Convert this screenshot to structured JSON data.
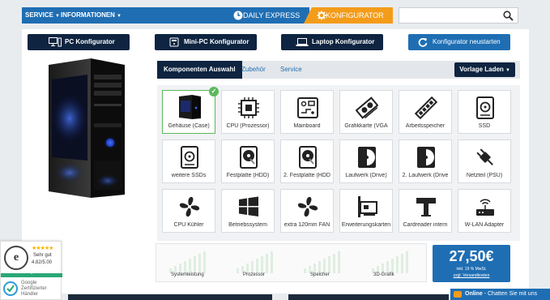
{
  "nav": {
    "service": "SERVICE",
    "informationen": "INFORMATIONEN",
    "daily_express": "DAILY EXPRESS",
    "konfigurator": "KONFIGURATOR",
    "search_placeholder": ""
  },
  "top_buttons": {
    "pc": "PC Konfigurator",
    "mini_pc": "Mini-PC Konfigurator",
    "laptop": "Laptop Konfigurator",
    "restart": "Konfigurator neustarten"
  },
  "tabs": {
    "komponenten": "Komponenten Auswahl",
    "zubehoer": "Zubehör",
    "service": "Service",
    "vorlage": "Vorlage Laden"
  },
  "components": [
    {
      "label": "Gehäuse (Case)",
      "icon": "case-image",
      "selected": true
    },
    {
      "label": "CPU (Prozessor)",
      "icon": "cpu-icon"
    },
    {
      "label": "Mainboard",
      "icon": "mainboard-icon"
    },
    {
      "label": "Grafikkarte (VGA",
      "icon": "graphics-card-icon"
    },
    {
      "label": "Arbeitsspeicher",
      "icon": "ram-icon"
    },
    {
      "label": "SSD",
      "icon": "ssd-icon"
    },
    {
      "label": "weitere SSDs",
      "icon": "ssd-icon"
    },
    {
      "label": "Festplatte (HDD)",
      "icon": "hdd-icon"
    },
    {
      "label": "2. Festplatte (HDD",
      "icon": "hdd-icon"
    },
    {
      "label": "Laufwerk (Drive)",
      "icon": "drive-icon"
    },
    {
      "label": "2. Laufwerk (Drive",
      "icon": "drive-icon"
    },
    {
      "label": "Netzteil (PSU)",
      "icon": "psu-plug-icon"
    },
    {
      "label": "CPU Kühler",
      "icon": "fan-icon"
    },
    {
      "label": "Betriebssystem",
      "icon": "windows-icon"
    },
    {
      "label": "extra 120mm FAN",
      "icon": "fan-icon"
    },
    {
      "label": "Erweiterungskarten",
      "icon": "expansion-card-icon"
    },
    {
      "label": "Cardreader intern",
      "icon": "cardreader-icon"
    },
    {
      "label": "W-LAN Adapter",
      "icon": "wlan-icon"
    }
  ],
  "performance": {
    "labels": [
      "Systemleistung",
      "Prozessor",
      "Speicher",
      "3D-Grafik"
    ]
  },
  "price": {
    "amount": "27,50€",
    "vat": "inkl. 19 % MwSt.",
    "shipping": "zzgl. Versandkosten"
  },
  "trust": {
    "rating_text": "Sehr gut",
    "score": "4.82/5.00",
    "stars": "★★★★★"
  },
  "google": {
    "line1": "Google",
    "line2": "Zertifizierter",
    "line3": "Händler"
  },
  "chat": {
    "status": "Online",
    "text": " - Chatten Sie mit uns"
  },
  "colors": {
    "primary_blue": "#1f6eb3",
    "navy": "#0e2440",
    "orange": "#f39c1a",
    "success_green": "#5cb85c"
  }
}
